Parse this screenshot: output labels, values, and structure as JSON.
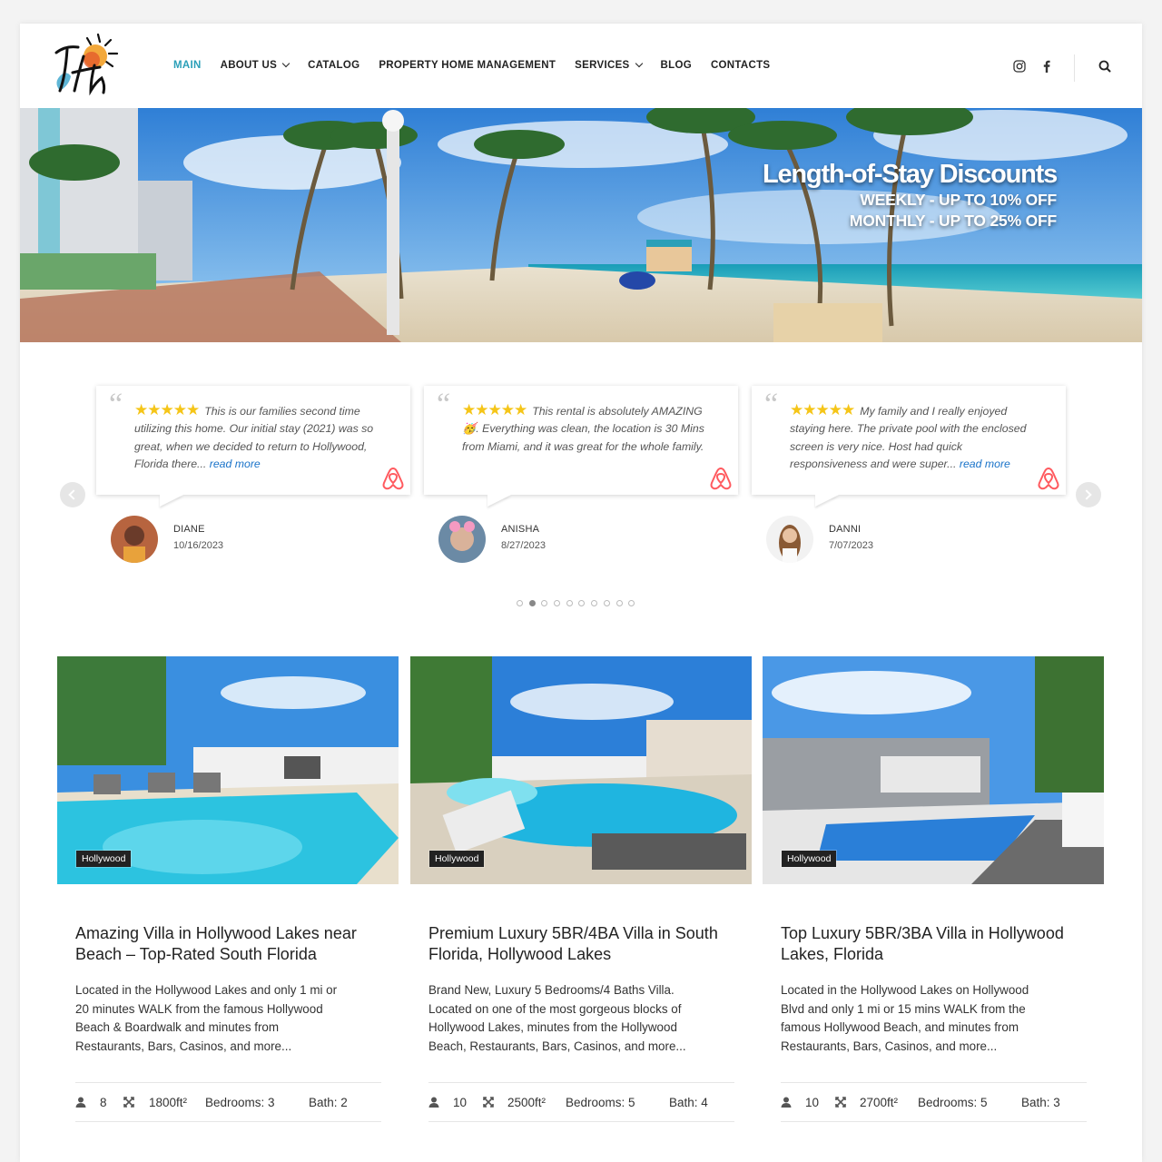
{
  "nav": {
    "items": [
      {
        "label": "MAIN",
        "active": true,
        "dropdown": false
      },
      {
        "label": "ABOUT US",
        "active": false,
        "dropdown": true
      },
      {
        "label": "CATALOG",
        "active": false,
        "dropdown": false
      },
      {
        "label": "PROPERTY HOME MANAGEMENT",
        "active": false,
        "dropdown": false
      },
      {
        "label": "SERVICES",
        "active": false,
        "dropdown": true
      },
      {
        "label": "BLOG",
        "active": false,
        "dropdown": false
      },
      {
        "label": "CONTACTS",
        "active": false,
        "dropdown": false
      }
    ],
    "accent_color": "#2a9fb8"
  },
  "hero": {
    "title": "Length-of-Stay Discounts",
    "line1": "WEEKLY - UP TO 10% OFF",
    "line2": "MONTHLY - UP TO 25% OFF"
  },
  "testimonials": [
    {
      "text": "This is our families second time utilizing this home. Our initial stay (2021) was so great, when we decided to return to Hollywood, Florida there...",
      "read_more": "read more",
      "stars": "★★★★★",
      "name": "DIANE",
      "date": "10/16/2023"
    },
    {
      "text": "This rental is absolutely AMAZING 🥳. Everything was clean, the location is 30 Mins from Miami, and it was great for the whole family.",
      "read_more": "",
      "stars": "★★★★★",
      "name": "ANISHA",
      "date": "8/27/2023"
    },
    {
      "text": "My family and I really enjoyed staying here. The private pool with the enclosed screen is very nice. Host had quick responsiveness and were super...",
      "read_more": "read more",
      "stars": "★★★★★",
      "name": "DANNI",
      "date": "7/07/2023"
    }
  ],
  "carousel": {
    "dot_count": 10,
    "active_dot": 2
  },
  "listings": [
    {
      "badge": "Hollywood",
      "title": "Amazing Villa in Hollywood Lakes near Beach – Top-Rated South Florida",
      "description": "Located in the Hollywood Lakes and only 1 mi or 20 minutes WALK from the famous Hollywood Beach & Boardwalk and minutes from Restaurants, Bars, Casinos, and more...",
      "guests": "8",
      "area": "1800ft²",
      "bedrooms": "Bedrooms: 3",
      "bath": "Bath: 2"
    },
    {
      "badge": "Hollywood",
      "title": "Premium Luxury 5BR/4BA Villa in South Florida, Hollywood Lakes",
      "description": "Brand New, Luxury 5 Bedrooms/4 Baths Villa. Located on one of the most gorgeous blocks of Hollywood Lakes, minutes from the Hollywood Beach, Restaurants, Bars, Casinos, and more...",
      "guests": "10",
      "area": "2500ft²",
      "bedrooms": "Bedrooms: 5",
      "bath": "Bath: 4"
    },
    {
      "badge": "Hollywood",
      "title": "Top Luxury 5BR/3BA Villa in Hollywood Lakes, Florida",
      "description": "Located in the Hollywood Lakes on Hollywood Blvd and only 1 mi or 15 mins WALK from the famous Hollywood Beach, and minutes from Restaurants, Bars, Casinos, and more...",
      "guests": "10",
      "area": "2700ft²",
      "bedrooms": "Bedrooms: 5",
      "bath": "Bath: 3"
    }
  ]
}
